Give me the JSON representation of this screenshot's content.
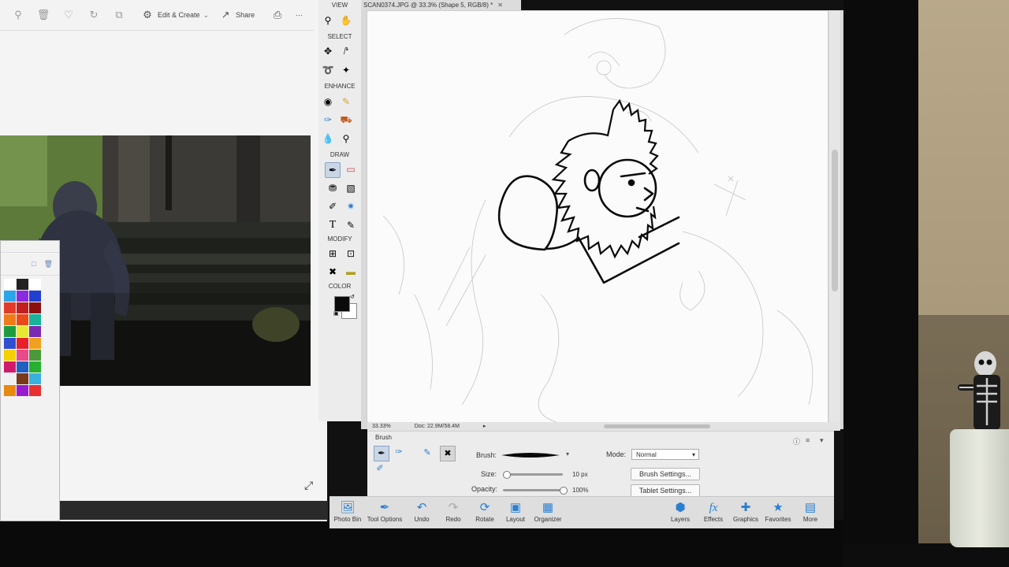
{
  "left_window": {
    "toolbar": {
      "edit_create_label": "Edit & Create",
      "share_label": "Share",
      "more_label": "···"
    }
  },
  "toolbox": {
    "sections": {
      "view": "VIEW",
      "select": "SELECT",
      "enhance": "ENHANCE",
      "draw": "DRAW",
      "modify": "MODIFY",
      "color": "COLOR"
    },
    "foreground_color": "#0a0a0a",
    "background_color": "#ffffff"
  },
  "document": {
    "tab_title": "SCAN0374.JPG @ 33.3% (Shape 5, RGB/8) *",
    "status_zoom": "33.33%",
    "status_doc": "Doc: 22.9M/58.4M"
  },
  "tool_options": {
    "section_label": "Brush",
    "brush_label": "Brush:",
    "size_label": "Size:",
    "size_value": "10 px",
    "size_fraction": 0.05,
    "opacity_label": "Opacity:",
    "opacity_value": "100%",
    "opacity_fraction": 1.0,
    "mode_label": "Mode:",
    "mode_value": "Normal",
    "brush_settings_label": "Brush Settings...",
    "tablet_settings_label": "Tablet Settings..."
  },
  "taskbar": {
    "left": [
      {
        "label": "Photo Bin",
        "icon": "photo-bin-icon"
      },
      {
        "label": "Tool Options",
        "icon": "tool-options-icon"
      },
      {
        "label": "Undo",
        "icon": "undo-icon"
      },
      {
        "label": "Redo",
        "icon": "redo-icon"
      },
      {
        "label": "Rotate",
        "icon": "rotate-icon"
      },
      {
        "label": "Layout",
        "icon": "layout-icon"
      },
      {
        "label": "Organizer",
        "icon": "organizer-icon"
      }
    ],
    "right": [
      {
        "label": "Layers",
        "icon": "layers-icon"
      },
      {
        "label": "Effects",
        "icon": "effects-icon"
      },
      {
        "label": "Graphics",
        "icon": "graphics-icon"
      },
      {
        "label": "Favorites",
        "icon": "favorites-icon"
      },
      {
        "label": "More",
        "icon": "more-icon"
      }
    ]
  },
  "colors": {
    "accent": "#2a7fd3",
    "panel_bg": "#ececec",
    "canvas_bg": "#fbfbfb"
  },
  "palette_swatches": [
    "#ffffff",
    "#222222",
    "#ffffff",
    "#2aa6e8",
    "#8a2be2",
    "#2040d0",
    "#e33b2b",
    "#c02020",
    "#8a1010",
    "#f07a1a",
    "#e84a1a",
    "#19b39a",
    "#1f9b3f",
    "#e8e830",
    "#7a2ab0",
    "#2f4fd0",
    "#e8202a",
    "#f0a020",
    "#f5d000",
    "#e84a8a",
    "#4a9a3a",
    "#d01a6a",
    "#2060c0",
    "#26b030",
    "#f0f0f0",
    "#7a3a1a",
    "#3ab0e0",
    "#e88a10",
    "#9a1ad0",
    "#e83030"
  ]
}
